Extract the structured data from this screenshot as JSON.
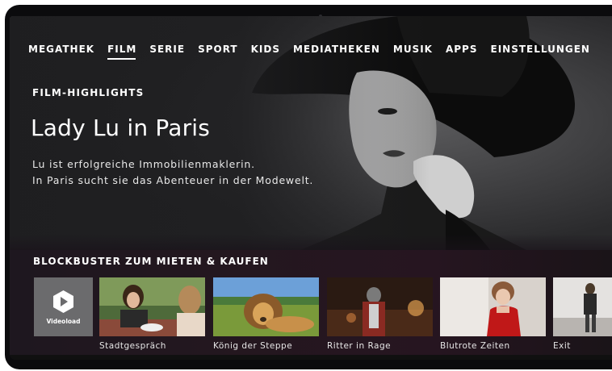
{
  "nav": {
    "items": [
      "MEGATHEK",
      "FILM",
      "SERIE",
      "SPORT",
      "KIDS",
      "MEDIATHEKEN",
      "MUSIK",
      "APPS",
      "EINSTELLUNGEN"
    ],
    "active_index": 1
  },
  "hero": {
    "eyebrow": "FILM-HIGHLIGHTS",
    "title": "Lady Lu in Paris",
    "line1": "Lu ist erfolgreiche Immobilienmaklerin.",
    "line2": "In Paris sucht sie das Abenteuer in der Modewelt."
  },
  "row": {
    "title": "BLOCKBUSTER ZUM MIETEN & KAUFEN",
    "provider_label": "Videoload",
    "tiles": [
      {
        "label": "Stadtgespräch"
      },
      {
        "label": "König der Steppe"
      },
      {
        "label": "Ritter in Rage"
      },
      {
        "label": "Blutrote Zeiten"
      },
      {
        "label": "Exit"
      }
    ]
  },
  "colors": {
    "accent": "#ffffff",
    "panel": "#1a1219"
  }
}
